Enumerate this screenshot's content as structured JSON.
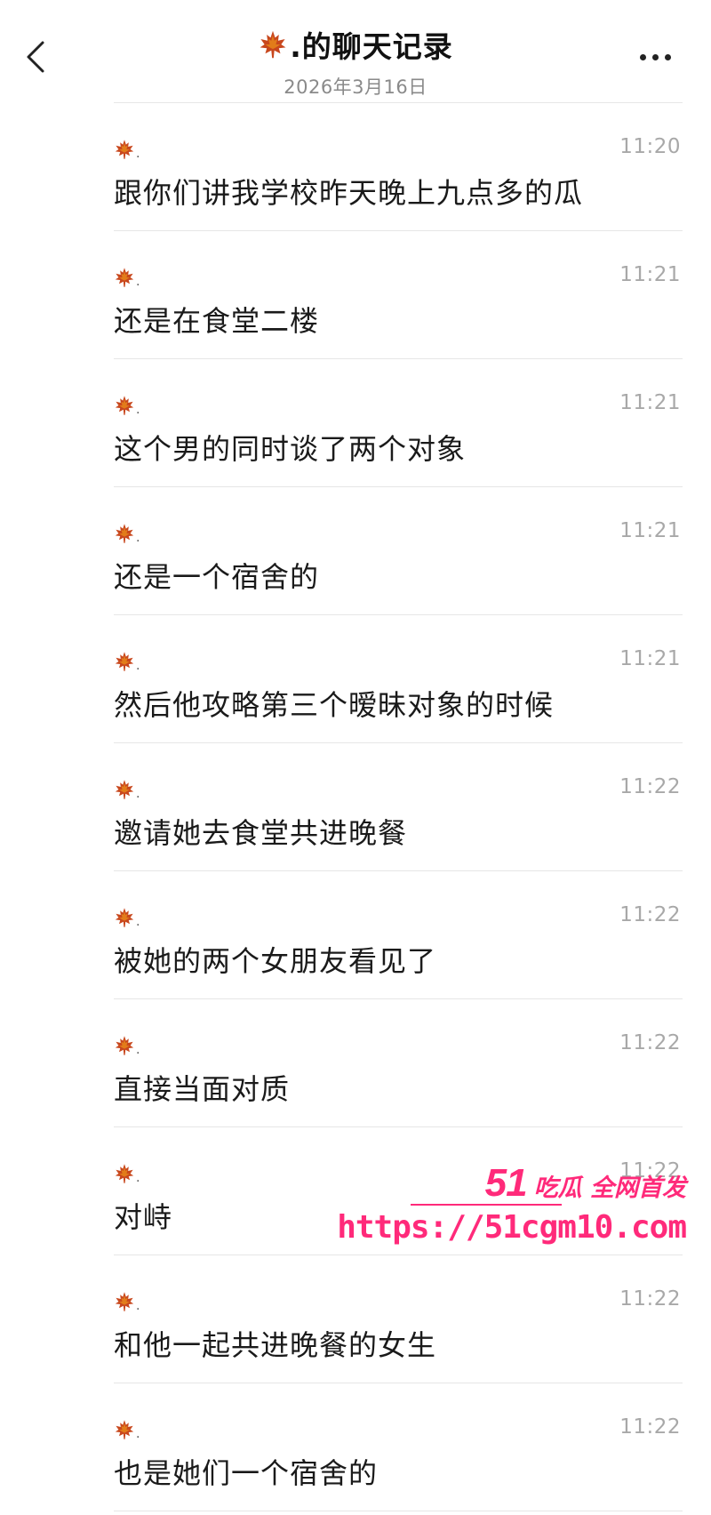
{
  "header": {
    "back_icon": "chevron-left-icon",
    "title": ".的聊天记录",
    "date": "2026年3月16日",
    "more_icon": "more-dots-icon"
  },
  "sender_avatar_icon": "maple-leaf-icon",
  "sender_name": ".",
  "colors": {
    "leaf_primary": "#c8471d",
    "leaf_secondary": "#e8891a",
    "watermark": "#ff2a7a",
    "divider": "#e6e6e6",
    "time": "#a8a8a8"
  },
  "messages": [
    {
      "time": "11:20",
      "text": "跟你们讲我学校昨天晚上九点多的瓜"
    },
    {
      "time": "11:21",
      "text": "还是在食堂二楼"
    },
    {
      "time": "11:21",
      "text": "这个男的同时谈了两个对象"
    },
    {
      "time": "11:21",
      "text": "还是一个宿舍的"
    },
    {
      "time": "11:21",
      "text": "然后他攻略第三个暧昧对象的时候"
    },
    {
      "time": "11:22",
      "text": "邀请她去食堂共进晚餐"
    },
    {
      "time": "11:22",
      "text": "被她的两个女朋友看见了"
    },
    {
      "time": "11:22",
      "text": "直接当面对质"
    },
    {
      "time": "11:22",
      "text": "对峙"
    },
    {
      "time": "11:22",
      "text": "和他一起共进晚餐的女生"
    },
    {
      "time": "11:22",
      "text": "也是她们一个宿舍的"
    }
  ],
  "watermark": {
    "brand_number": "51",
    "brand_text": "吃瓜 全网首发",
    "url": "https://51cgm10.com"
  }
}
